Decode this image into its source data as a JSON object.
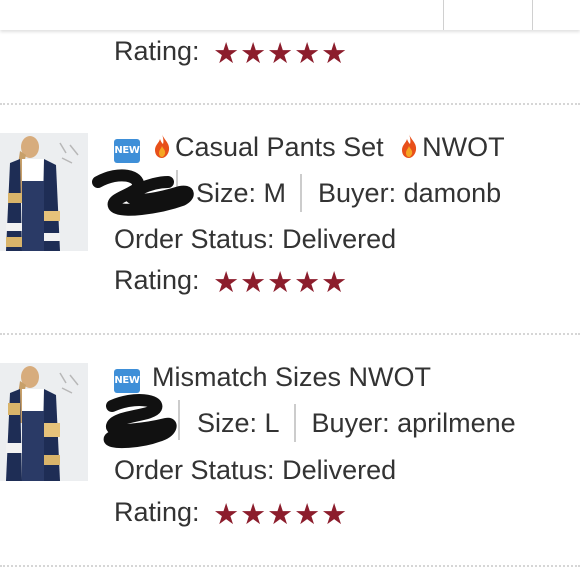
{
  "orders": [
    {
      "rating_label": "Rating:",
      "rating_stars": 5
    },
    {
      "badge": "NEW",
      "title": "Casual Pants Set",
      "suffix": "NWOT",
      "size": "Size: M",
      "buyer": "Buyer: damonb",
      "status": "Order Status: Delivered",
      "rating_label": "Rating:",
      "rating_stars": 5
    },
    {
      "badge": "NEW",
      "title": "Mismatch Sizes NWOT",
      "size": "Size: L",
      "buyer": "Buyer: aprilmene",
      "status": "Order Status: Delivered",
      "rating_label": "Rating:",
      "rating_stars": 5
    }
  ],
  "colors": {
    "star": "#8c1d2c",
    "badge": "#3e8fd8",
    "fire": "#e8501a"
  },
  "icons": [
    "new-badge-icon",
    "fire-icon",
    "star-icon"
  ]
}
